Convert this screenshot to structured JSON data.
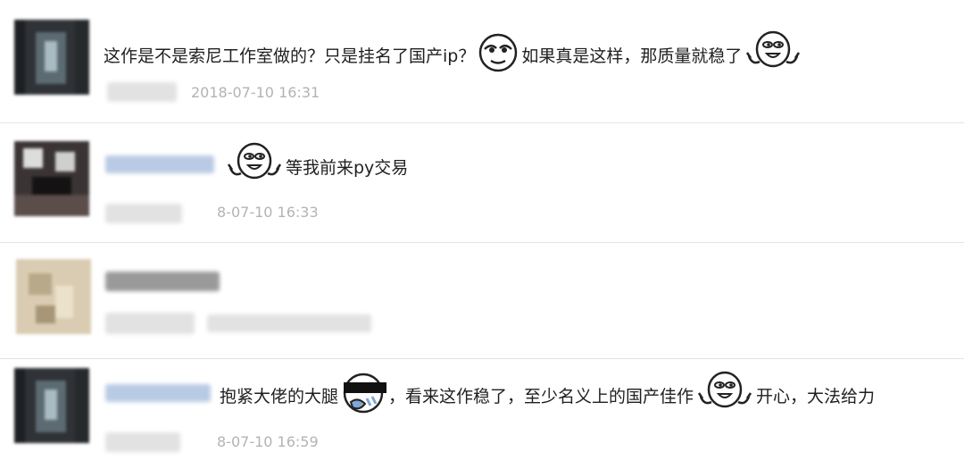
{
  "comments": [
    {
      "text_a": "这作是不是索尼工作室做的？只是挂名了国产ip？",
      "emoji_a": "smirk-face-icon",
      "text_b": "如果真是这样，那质量就稳了",
      "emoji_b": "happy-waving-face-icon",
      "time": "2018-07-10 16:31"
    },
    {
      "emoji_a": "happy-waving-face-icon",
      "text_a": "等我前来py交易",
      "time": "8-07-10 16:33"
    },
    {
      "text_a": "",
      "time": ""
    },
    {
      "text_a": "抱紧大佬的大腿",
      "emoji_a": "crying-face-icon",
      "text_b": "，看来这作稳了，至少名义上的国产佳作",
      "emoji_b": "happy-waving-face-icon",
      "text_c": "开心，大法给力",
      "time": "8-07-10 16:59"
    }
  ],
  "colors": {
    "separator": "#e3e3e3",
    "timestamp": "#b3b3b3",
    "name_blue": "#b9cbe4",
    "text": "#1f1f1f"
  }
}
